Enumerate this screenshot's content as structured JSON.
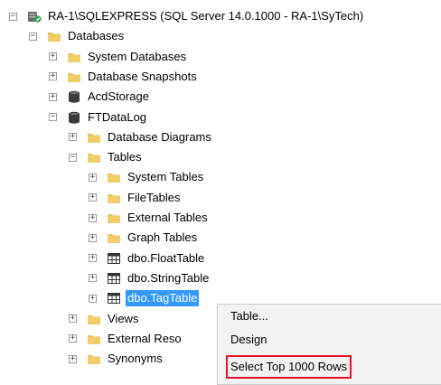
{
  "tree": [
    {
      "label": "RA-1\\SQLEXPRESS (SQL Server 14.0.1000 - RA-1\\SyTech)",
      "icon": "server-icon",
      "expander": "−",
      "level": 0
    },
    {
      "label": "Databases",
      "icon": "folder-icon",
      "expander": "−",
      "level": 1
    },
    {
      "label": "System Databases",
      "icon": "folder-icon",
      "expander": "+",
      "level": 2
    },
    {
      "label": "Database Snapshots",
      "icon": "folder-icon",
      "expander": "+",
      "level": 2
    },
    {
      "label": "AcdStorage",
      "icon": "database-icon",
      "expander": "+",
      "level": 2
    },
    {
      "label": "FTDataLog",
      "icon": "database-icon",
      "expander": "−",
      "level": 2
    },
    {
      "label": "Database Diagrams",
      "icon": "folder-icon",
      "expander": "+",
      "level": 3
    },
    {
      "label": "Tables",
      "icon": "folder-icon",
      "expander": "−",
      "level": 3
    },
    {
      "label": "System Tables",
      "icon": "folder-icon",
      "expander": "+",
      "level": 4
    },
    {
      "label": "FileTables",
      "icon": "folder-icon",
      "expander": "+",
      "level": 4
    },
    {
      "label": "External Tables",
      "icon": "folder-icon",
      "expander": "+",
      "level": 4
    },
    {
      "label": "Graph Tables",
      "icon": "folder-icon",
      "expander": "+",
      "level": 4
    },
    {
      "label": "dbo.FloatTable",
      "icon": "table-icon",
      "expander": "+",
      "level": 4
    },
    {
      "label": "dbo.StringTable",
      "icon": "table-icon",
      "expander": "+",
      "level": 4
    },
    {
      "label": "dbo.TagTable",
      "icon": "table-icon",
      "expander": "+",
      "level": 4,
      "selected": true
    },
    {
      "label": "Views",
      "icon": "folder-icon",
      "expander": "+",
      "level": 3
    },
    {
      "label": "External Reso",
      "icon": "folder-icon",
      "expander": "+",
      "level": 3
    },
    {
      "label": "Synonyms",
      "icon": "folder-icon",
      "expander": "+",
      "level": 3
    }
  ],
  "context_menu": {
    "items": [
      {
        "label": "Table..."
      },
      {
        "label": "Design"
      },
      {
        "label": "Select Top 1000 Rows",
        "highlighted": true
      }
    ]
  },
  "colors": {
    "folder": "#e8c25c",
    "selection": "#3399ff",
    "highlight_border": "#e8112d",
    "menu_bg": "#f2f2f2"
  }
}
